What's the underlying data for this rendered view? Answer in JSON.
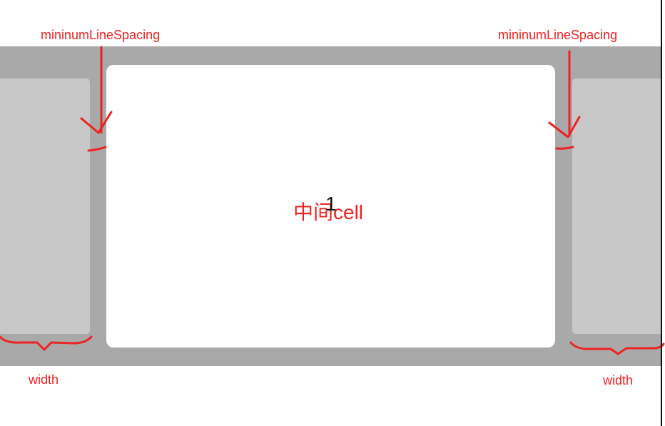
{
  "annotations": {
    "spacing_left": "mininumLineSpacing",
    "spacing_right": "mininumLineSpacing",
    "width_left": "width",
    "width_right": "width"
  },
  "center_cell": {
    "label": "中间cell",
    "index": "1"
  },
  "colors": {
    "annotation": "#ee2222",
    "strip": "#a9a9a9",
    "side_cell": "#c8c8c8",
    "center_cell": "#ffffff"
  }
}
